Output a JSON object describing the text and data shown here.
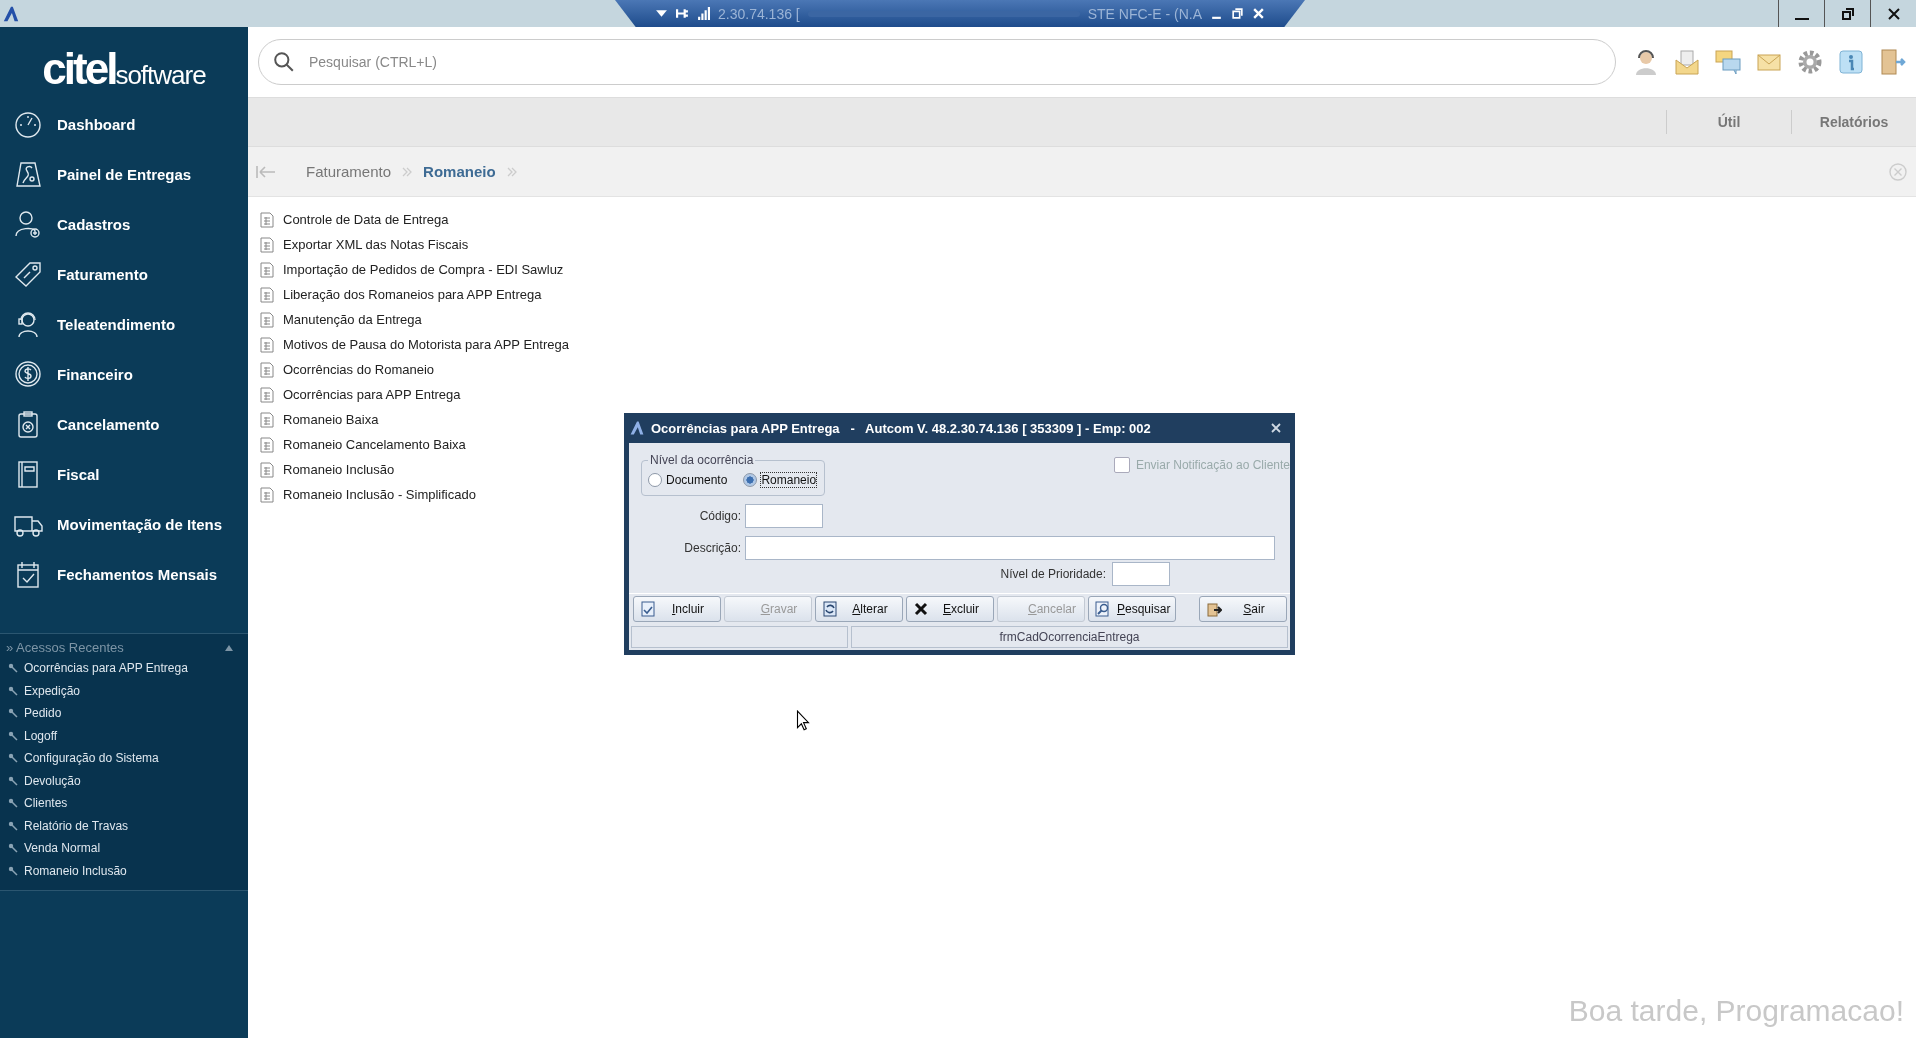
{
  "remote_bar": {
    "fragments": [
      "2.30.74.136 [",
      "STE NFC-E - (N.A"
    ]
  },
  "sidebar": {
    "logo_main": "citel",
    "logo_sub": "software",
    "items": [
      {
        "label": "Dashboard",
        "kind": "gauge"
      },
      {
        "label": "Painel de Entregas",
        "kind": "map"
      },
      {
        "label": "Cadastros",
        "kind": "user"
      },
      {
        "label": "Faturamento",
        "kind": "tag"
      },
      {
        "label": "Teleatendimento",
        "kind": "headset"
      },
      {
        "label": "Financeiro",
        "kind": "coin"
      },
      {
        "label": "Cancelamento",
        "kind": "clipboard"
      },
      {
        "label": "Fiscal",
        "kind": "book"
      },
      {
        "label": "Movimentação de Itens",
        "kind": "truck"
      },
      {
        "label": "Fechamentos Mensais",
        "kind": "calendar"
      }
    ],
    "recent": {
      "title": "» Acessos Recentes",
      "expanded": true,
      "items": [
        "Ocorrências para APP Entrega",
        "Expedição",
        "Pedido",
        "Logoff",
        "Configuração do Sistema",
        "Devolução",
        "Clientes",
        "Relatório de Travas",
        "Venda Normal",
        "Romaneio Inclusão"
      ]
    }
  },
  "search": {
    "placeholder": "Pesquisar (CTRL+L)"
  },
  "toolbar_tabs": [
    "Útil",
    "Relatórios"
  ],
  "breadcrumb": [
    {
      "label": "Faturamento",
      "selected": false
    },
    {
      "label": "Romaneio",
      "selected": true
    }
  ],
  "menu_items": [
    "Controle de Data de Entrega",
    "Exportar XML das Notas Fiscais",
    "Importação de Pedidos de Compra - EDI Sawluz",
    "Liberação dos Romaneios para APP Entrega",
    "Manutenção da Entrega",
    "Motivos de Pausa do Motorista para APP Entrega",
    "Ocorrências do Romaneio",
    "Ocorrências para APP Entrega",
    "Romaneio Baixa",
    "Romaneio Cancelamento Baixa",
    "Romaneio Inclusão",
    "Romaneio Inclusão - Simplificado"
  ],
  "dialog": {
    "title": "Ocorrências para APP Entrega   -   Autcom V. 48.2.30.74.136 [ 353309 ] - Emp: 002",
    "group_label": "Nível da ocorrência",
    "radios": [
      {
        "label": "Documento",
        "selected": false
      },
      {
        "label": "Romaneio",
        "selected": true
      }
    ],
    "notify": {
      "label": "Enviar Notificação ao Cliente",
      "checked": false,
      "disabled": true
    },
    "code_label": "Código:",
    "description_label": "Descrição:",
    "priority_label": "Nível de Prioridade:",
    "buttons": [
      {
        "label": "Incluir",
        "kind": "add",
        "disabled": false
      },
      {
        "label": "Gravar",
        "kind": "save",
        "disabled": true
      },
      {
        "label": "Alterar",
        "kind": "edit",
        "disabled": false
      },
      {
        "label": "Excluir",
        "kind": "delete",
        "disabled": false
      },
      {
        "label": "Cancelar",
        "kind": "cancel",
        "disabled": true
      },
      {
        "label": "Pesquisar",
        "kind": "search",
        "disabled": false
      },
      {
        "label": "Sair",
        "kind": "exit",
        "disabled": false
      }
    ],
    "status": "frmCadOcorrenciaEntrega"
  },
  "greeting": "Boa tarde, Programacao!"
}
